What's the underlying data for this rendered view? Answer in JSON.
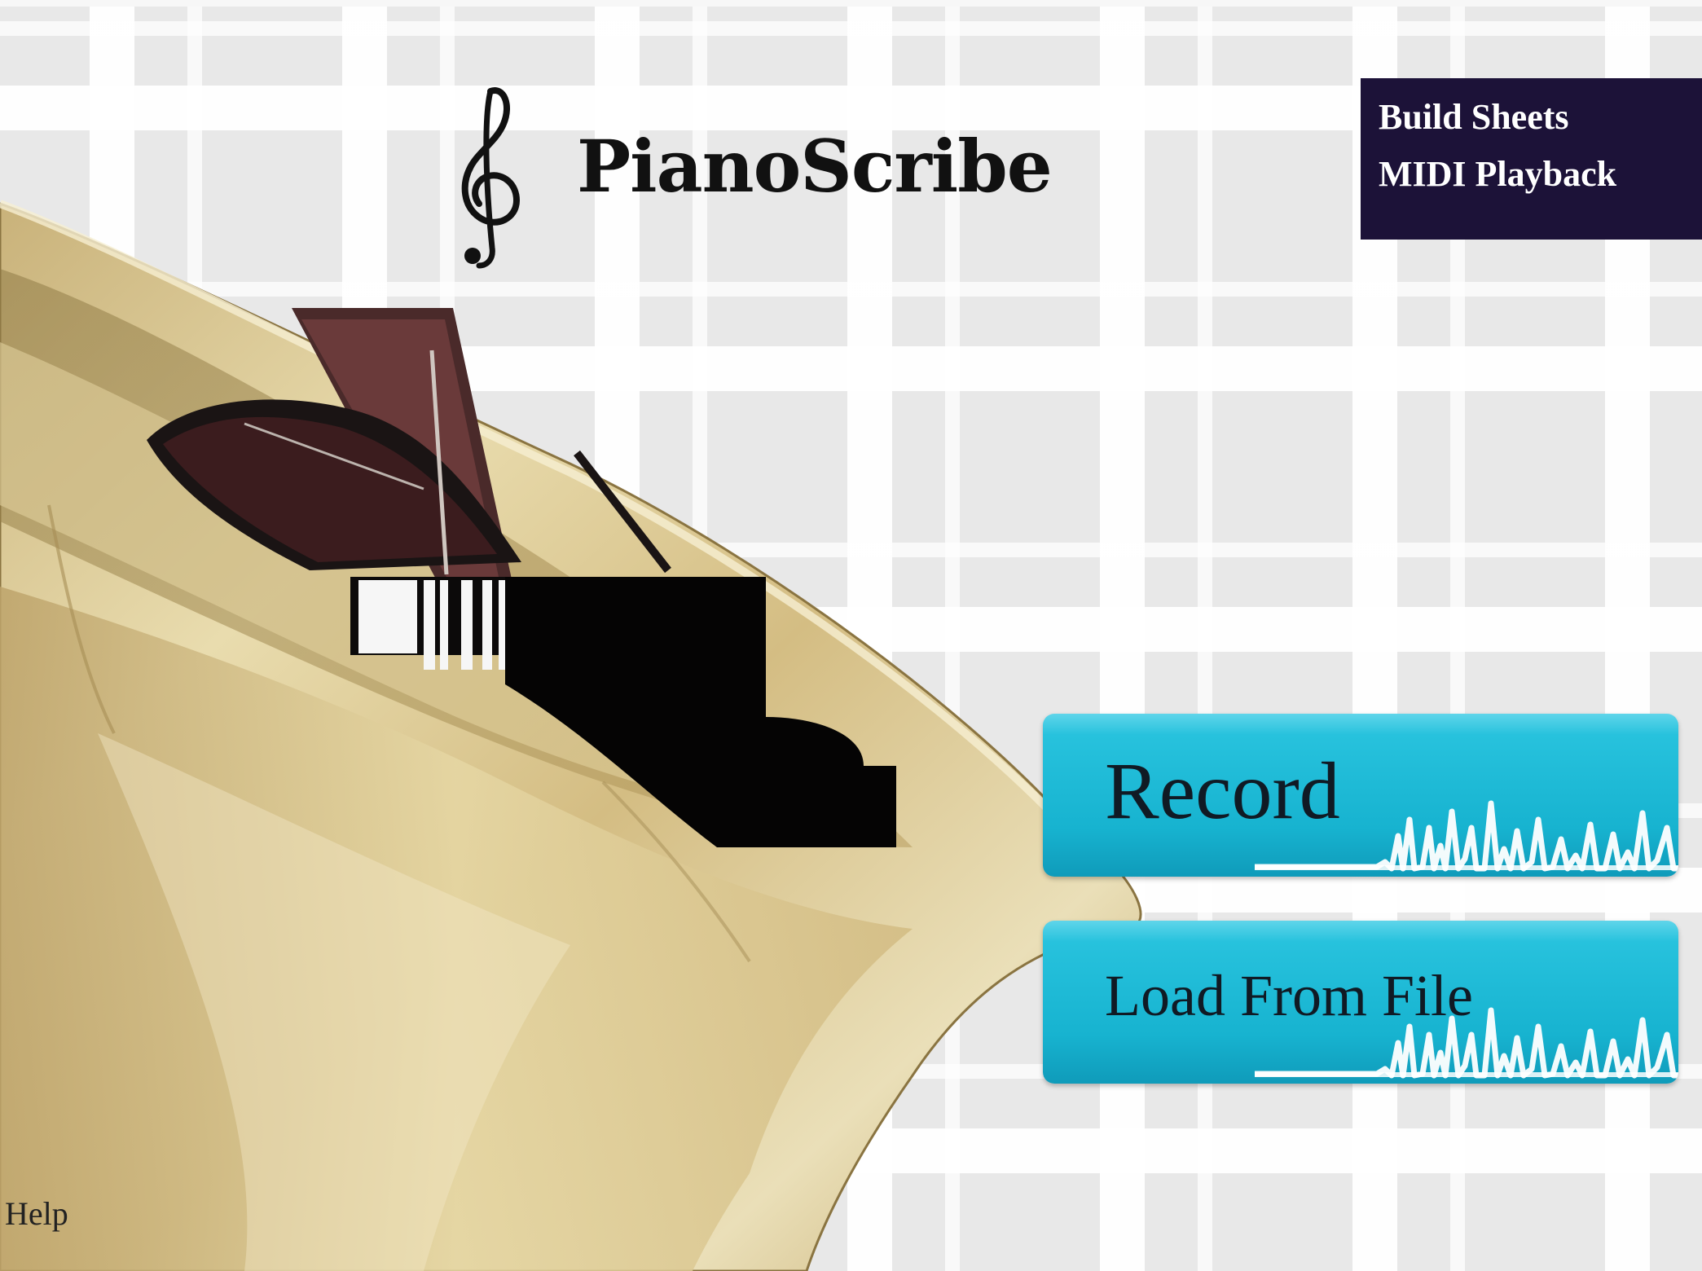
{
  "app": {
    "title": "PianoScribe",
    "logo_icon": "treble-clef-icon",
    "hero_image": "brass-horn-with-grand-piano"
  },
  "nav": {
    "items": [
      {
        "label": "Build Sheets"
      },
      {
        "label": "MIDI Playback"
      }
    ]
  },
  "actions": {
    "record": {
      "label": "Record",
      "icon": "waveform-icon"
    },
    "load": {
      "label": "Load From File",
      "icon": "waveform-icon"
    }
  },
  "footer": {
    "help_label": "Help"
  },
  "colors": {
    "nav_background": "#1c1238",
    "button_accent": "#19b7d4",
    "button_text": "#101a24",
    "brass": "#d9c48f",
    "background": "#e8e8e8"
  }
}
